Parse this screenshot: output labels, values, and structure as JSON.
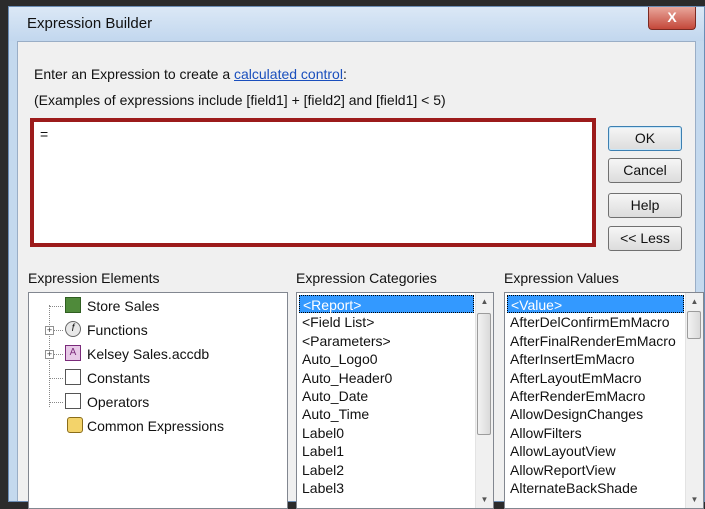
{
  "window": {
    "title": "Expression Builder",
    "close_glyph": "X"
  },
  "instructions": {
    "line1_prefix": "Enter an Expression to create a ",
    "line1_link": "calculated control",
    "line1_suffix": ":",
    "line2": "(Examples of expressions include [field1] + [field2] and [field1] < 5)"
  },
  "expression": {
    "value": "="
  },
  "buttons": {
    "ok": "OK",
    "cancel": "Cancel",
    "help": "Help",
    "less": "<< Less"
  },
  "elements": {
    "label": "Expression Elements",
    "items": [
      {
        "label": "Store Sales",
        "icon": "form-icon"
      },
      {
        "label": "Functions",
        "icon": "function-icon"
      },
      {
        "label": "Kelsey Sales.accdb",
        "icon": "database-icon"
      },
      {
        "label": "Constants",
        "icon": "constants-icon"
      },
      {
        "label": "Operators",
        "icon": "operators-icon"
      },
      {
        "label": "Common Expressions",
        "icon": "common-expressions-icon"
      }
    ]
  },
  "categories": {
    "label": "Expression Categories",
    "items": [
      "<Report>",
      "<Field List>",
      "<Parameters>",
      "Auto_Logo0",
      "Auto_Header0",
      "Auto_Date",
      "Auto_Time",
      "Label0",
      "Label1",
      "Label2",
      "Label3"
    ],
    "selected_index": 0
  },
  "values": {
    "label": "Expression Values",
    "items": [
      "<Value>",
      "AfterDelConfirmEmMacro",
      "AfterFinalRenderEmMacro",
      "AfterInsertEmMacro",
      "AfterLayoutEmMacro",
      "AfterRenderEmMacro",
      "AllowDesignChanges",
      "AllowFilters",
      "AllowLayoutView",
      "AllowReportView",
      "AlternateBackShade"
    ],
    "selected_index": 0
  },
  "colors": {
    "highlight": "#3399ff",
    "callout_border": "#9c1b1b",
    "link": "#1a4fbd"
  }
}
